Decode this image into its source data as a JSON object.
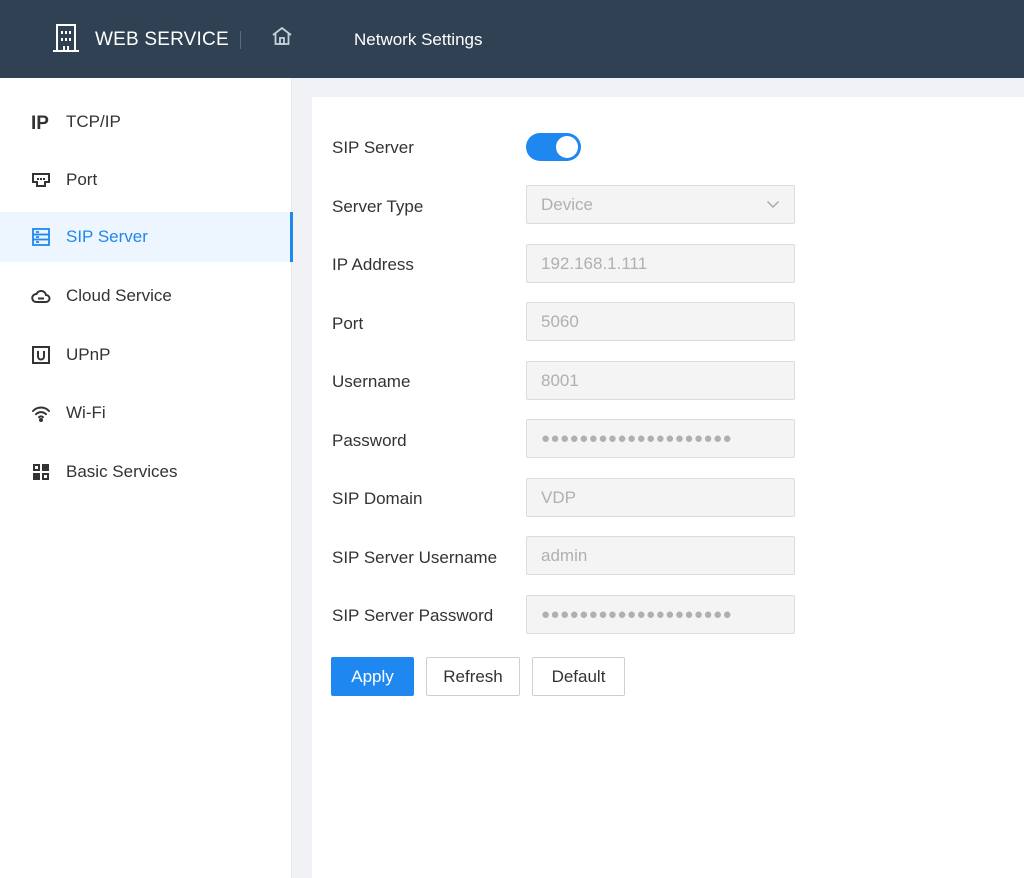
{
  "header": {
    "brand_icon": "building-icon",
    "app_name": "WEB SERVICE",
    "home_icon": "home-icon",
    "page_title": "Network Settings",
    "bg_color": "#2f4153"
  },
  "sidebar": {
    "items": [
      {
        "label": "TCP/IP",
        "icon": "ip-icon",
        "active": false
      },
      {
        "label": "Port",
        "icon": "port-icon",
        "active": false
      },
      {
        "label": "SIP Server",
        "icon": "sip-server-icon",
        "active": true
      },
      {
        "label": "Cloud Service",
        "icon": "cloud-icon",
        "active": false
      },
      {
        "label": "UPnP",
        "icon": "upnp-icon",
        "active": false
      },
      {
        "label": "Wi-Fi",
        "icon": "wifi-icon",
        "active": false
      },
      {
        "label": "Basic Services",
        "icon": "grid-icon",
        "active": false
      }
    ],
    "accent_color": "#1e88f0"
  },
  "form": {
    "sip_server": {
      "label": "SIP Server",
      "enabled": true
    },
    "server_type": {
      "label": "Server Type",
      "value": "Device"
    },
    "ip_address": {
      "label": "IP Address",
      "value": "192.168.1.111"
    },
    "port": {
      "label": "Port",
      "value": "5060"
    },
    "username": {
      "label": "Username",
      "value": "8001"
    },
    "password": {
      "label": "Password",
      "value": "●●●●●●●●●●●●●●●●●●●●"
    },
    "sip_domain": {
      "label": "SIP Domain",
      "value": "VDP"
    },
    "sip_server_username": {
      "label": "SIP Server Username",
      "value": "admin"
    },
    "sip_server_password": {
      "label": "SIP Server Password",
      "value": "●●●●●●●●●●●●●●●●●●●●"
    }
  },
  "actions": {
    "apply": "Apply",
    "refresh": "Refresh",
    "default": "Default"
  }
}
